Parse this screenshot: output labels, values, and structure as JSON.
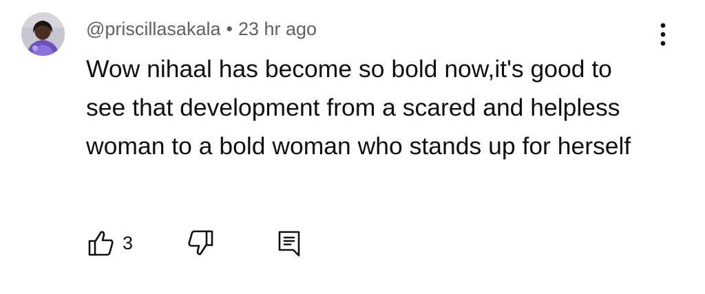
{
  "comment": {
    "author": "@priscillasakala",
    "separator": "•",
    "timestamp": "23 hr ago",
    "text": "Wow nihaal has become so bold now,it's good to see that development from a scared and helpless woman to a bold woman who stands up for herself",
    "like_count": "3"
  },
  "icons": {
    "avatar": "avatar-image",
    "more": "more-vert-icon",
    "like": "thumb-up-icon",
    "dislike": "thumb-down-icon",
    "reply": "comment-reply-icon"
  },
  "colors": {
    "text_primary": "#0f0f0f",
    "text_secondary": "#606060"
  }
}
